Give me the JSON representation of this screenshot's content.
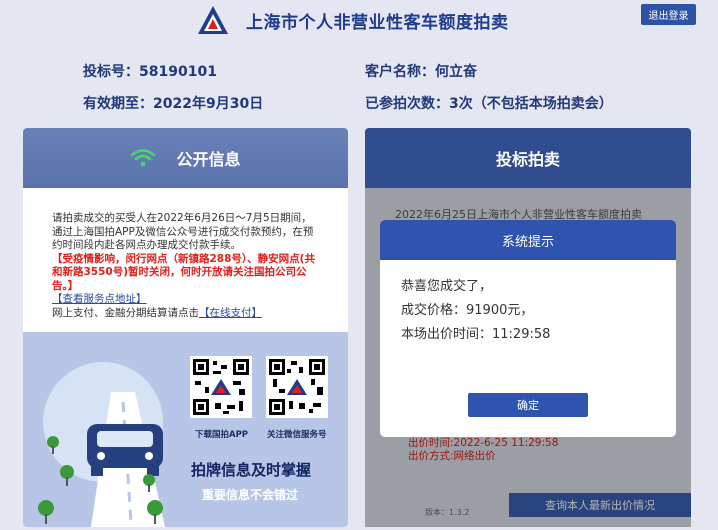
{
  "header": {
    "title": "上海市个人非营业性客车额度拍卖",
    "logout_label": "退出登录"
  },
  "info": {
    "bid_number": "投标号：58190101",
    "customer_name": "客户名称：何立奋",
    "valid_until": "有效期至：2022年9月30日",
    "participation": "已参拍次数：3次（不包括本场拍卖会）"
  },
  "public_info": {
    "title": "公开信息",
    "notice_line1": "请拍卖成交的买受人在2022年6月26日～7月5日期间，通过上海国拍APP及微信公众号进行成交付款预约，在预约时间段内赴各网点办理成交付款手续。",
    "notice_red": "【受疫情影响，闵行网点（新镇路288号）、静安网点(共和新路3550号)暂时关闭，何时开放请关注国拍公司公告。】",
    "address_link": "【查看服务点地址】",
    "pay_text": "网上支付、金融分期结算请点击",
    "pay_link": "【在线支付】",
    "qr_app_label": "下载国拍APP",
    "qr_wechat_label": "关注微信服务号",
    "slogan_main": "拍牌信息及时掌握",
    "slogan_sub": "重要信息不会错过"
  },
  "bidding": {
    "title": "投标拍卖",
    "bg_text": "2022年6月25日上海市个人非营业性客车额度拍卖",
    "bid_time": "出价时间:2022-6-25 11:29:58",
    "bid_method": "出价方式:网络出价",
    "version": "版本：1.3.2",
    "query_label": "查询本人最新出价情况"
  },
  "dialog": {
    "title": "系统提示",
    "line1": "恭喜您成交了，",
    "line2": "成交价格：91900元，",
    "line3": "本场出价时间：11:29:58",
    "ok_label": "确定"
  }
}
